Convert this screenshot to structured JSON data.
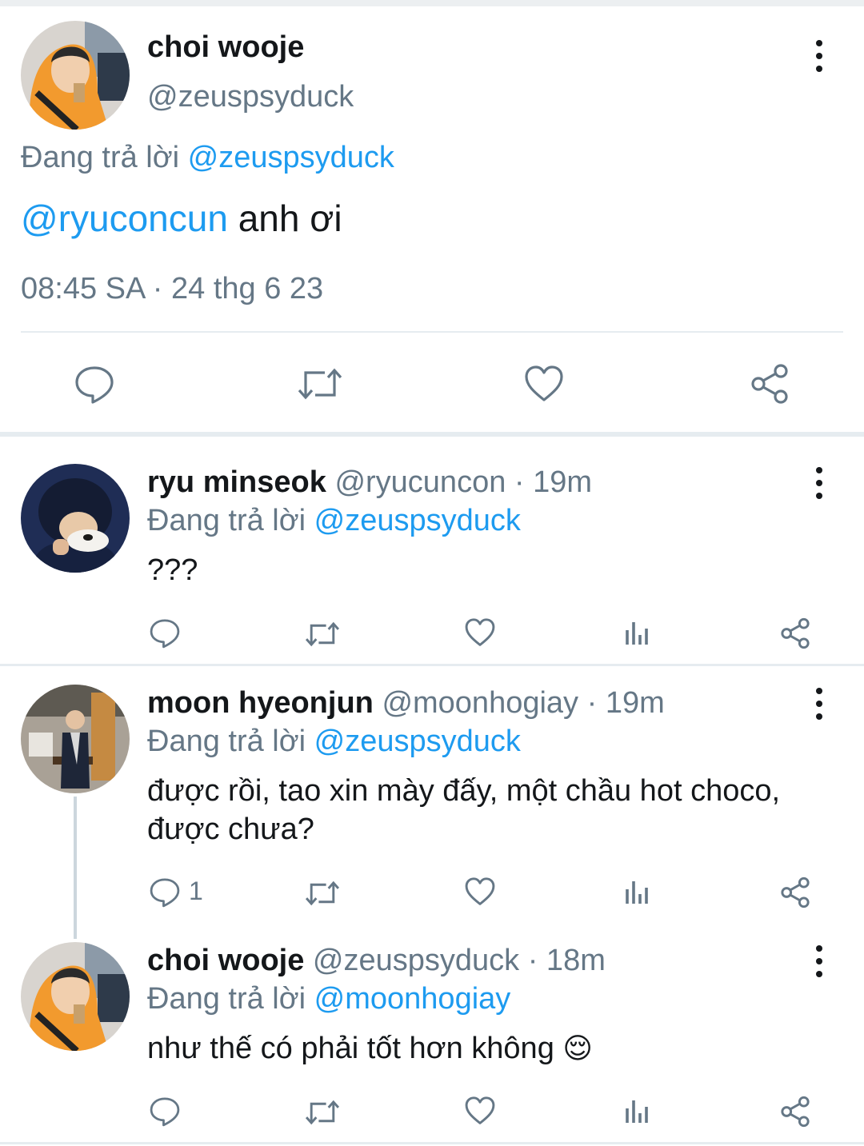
{
  "main_tweet": {
    "display_name": "choi wooje",
    "handle": "@zeuspsyduck",
    "replying_prefix": "Đang trả lời",
    "replying_to": "@zeuspsyduck",
    "mention": "@ryuconcun",
    "text": " anh ơi",
    "timestamp": "08:45 SA · 24 thg 6 23",
    "actions": [
      "reply-icon",
      "retweet-icon",
      "like-icon",
      "share-icon"
    ]
  },
  "replies": [
    {
      "display_name": "ryu minseok",
      "meta": "@ryucuncon · 19m",
      "replying_prefix": "Đang trả lời",
      "replying_to": "@zeuspsyduck",
      "text": "???",
      "reply_count": ""
    },
    {
      "display_name": "moon hyeonjun",
      "meta": "@moonhogiay · 19m",
      "replying_prefix": "Đang trả lời",
      "replying_to": "@zeuspsyduck",
      "text_line1": "được rồi, tao xin mày đấy, một chầu hot choco,",
      "text_line2": "được chưa?",
      "reply_count": "1"
    },
    {
      "display_name": "choi wooje",
      "meta": "@zeuspsyduck · 18m",
      "replying_prefix": "Đang trả lời",
      "replying_to": "@moonhogiay",
      "text": "như thế có phải tốt hơn không",
      "emoji": "😌",
      "reply_count": ""
    }
  ],
  "colors": {
    "accent": "#1d9bf0",
    "muted": "#657786",
    "divider": "#e6ecf0"
  }
}
